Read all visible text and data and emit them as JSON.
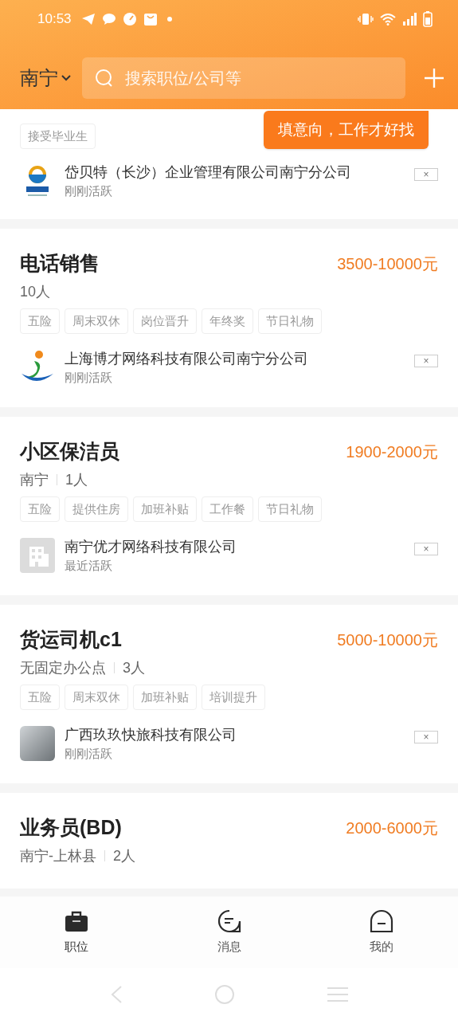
{
  "status_bar": {
    "time": "10:53"
  },
  "header": {
    "city": "南宁",
    "search_placeholder": "搜索职位/公司等",
    "tooltip": "填意向，工作才好找"
  },
  "jobs": [
    {
      "kind": "partial",
      "tags": [
        "接受毕业生"
      ],
      "company": {
        "name": "岱贝特（长沙）企业管理有限公司南宁分公司",
        "activity": "刚刚活跃"
      },
      "dismiss": "×"
    },
    {
      "kind": "full",
      "title": "电话销售",
      "salary": "3500-10000元",
      "meta": [
        "10人"
      ],
      "tags": [
        "五险",
        "周末双休",
        "岗位晋升",
        "年终奖",
        "节日礼物"
      ],
      "company": {
        "name": "上海博才网络科技有限公司南宁分公司",
        "activity": "刚刚活跃"
      },
      "dismiss": "×"
    },
    {
      "kind": "full",
      "title": "小区保洁员",
      "salary": "1900-2000元",
      "meta": [
        "南宁",
        "1人"
      ],
      "tags": [
        "五险",
        "提供住房",
        "加班补贴",
        "工作餐",
        "节日礼物"
      ],
      "company": {
        "name": "南宁优才网络科技有限公司",
        "activity": "最近活跃"
      },
      "dismiss": "×"
    },
    {
      "kind": "full",
      "title": "货运司机c1",
      "salary": "5000-10000元",
      "meta": [
        "无固定办公点",
        "3人"
      ],
      "tags": [
        "五险",
        "周末双休",
        "加班补贴",
        "培训提升"
      ],
      "company": {
        "name": "广西玖玖快旅科技有限公司",
        "activity": "刚刚活跃"
      },
      "dismiss": "×"
    },
    {
      "kind": "full",
      "title": "业务员(BD)",
      "salary": "2000-6000元",
      "meta": [
        "南宁-上林县",
        "2人"
      ]
    }
  ],
  "bottom_nav": [
    {
      "label": "职位",
      "selected": true
    },
    {
      "label": "消息",
      "selected": false
    },
    {
      "label": "我的",
      "selected": false
    }
  ]
}
